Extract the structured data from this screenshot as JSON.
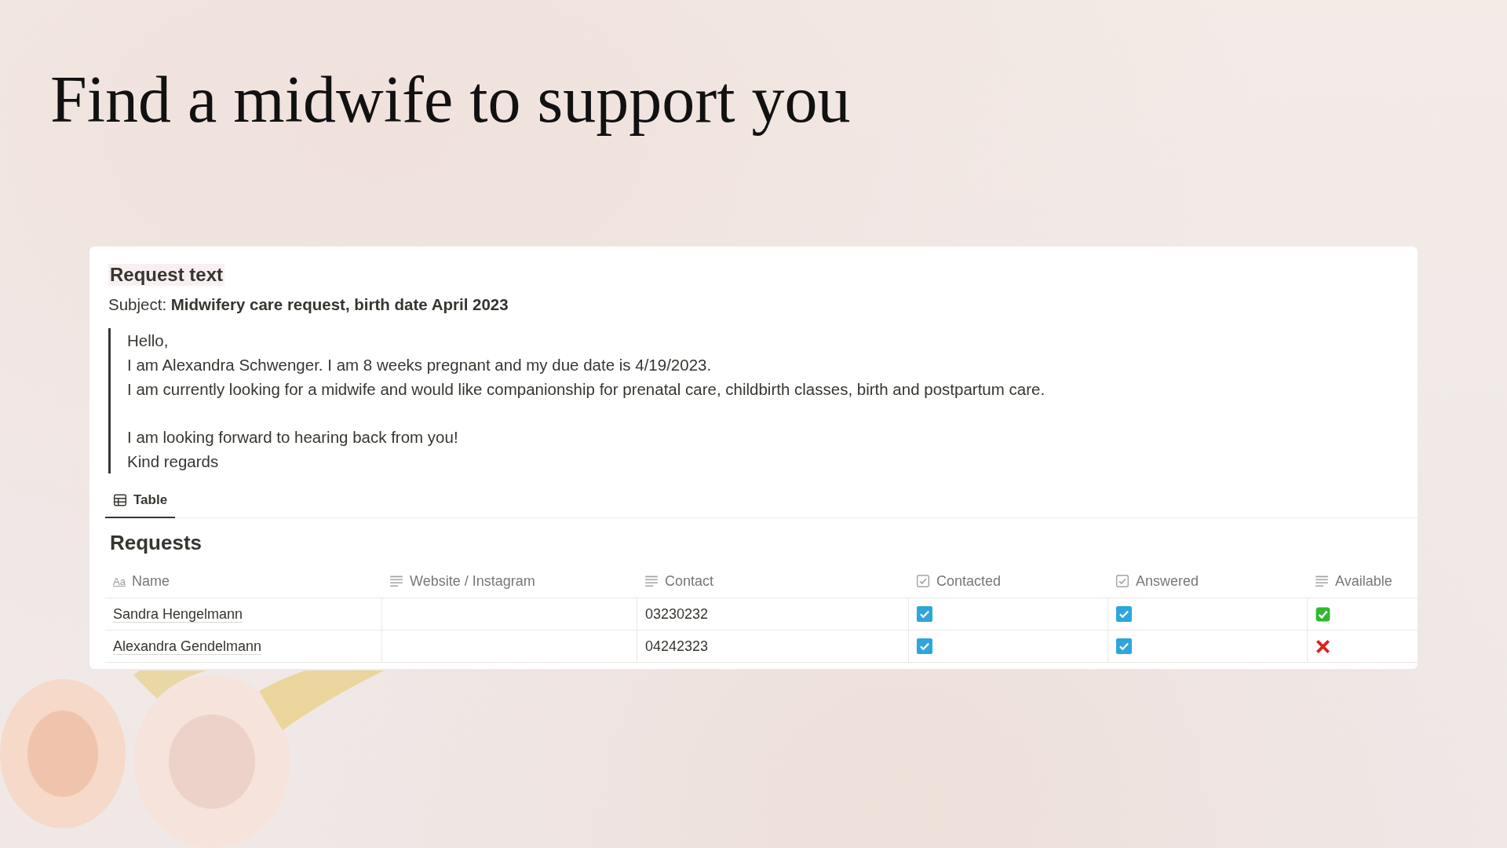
{
  "title": "Find a midwife to support you",
  "request": {
    "heading": "Request text",
    "subject_label": "Subject:",
    "subject": "Midwifery care request, birth date April 2023",
    "letter": [
      [
        "Hello,",
        "I am Alexandra Schwenger. I am 8 weeks pregnant and my due date is 4/19/2023.",
        "I am currently looking for a midwife and would like companionship for prenatal care, childbirth classes, birth and postpartum care."
      ],
      [
        "I am looking forward to hearing back from you!",
        "Kind regards"
      ]
    ]
  },
  "views": [
    {
      "label": "Table",
      "selected": true
    }
  ],
  "table": {
    "title": "Requests",
    "columns": [
      {
        "label": "Name",
        "kind": "title",
        "icon": "Aa"
      },
      {
        "label": "Website / Instagram",
        "kind": "text"
      },
      {
        "label": "Contact",
        "kind": "text"
      },
      {
        "label": "Contacted",
        "kind": "checkbox"
      },
      {
        "label": "Answered",
        "kind": "checkbox"
      },
      {
        "label": "Available",
        "kind": "text"
      }
    ],
    "rows": [
      {
        "name": "Sandra Hengelmann",
        "contact": "03230232",
        "contacted": true,
        "answered": true,
        "available": true
      },
      {
        "name": "Alexandra Gendelmann",
        "contact": "04242323",
        "contacted": true,
        "answered": true,
        "available": false
      }
    ]
  }
}
